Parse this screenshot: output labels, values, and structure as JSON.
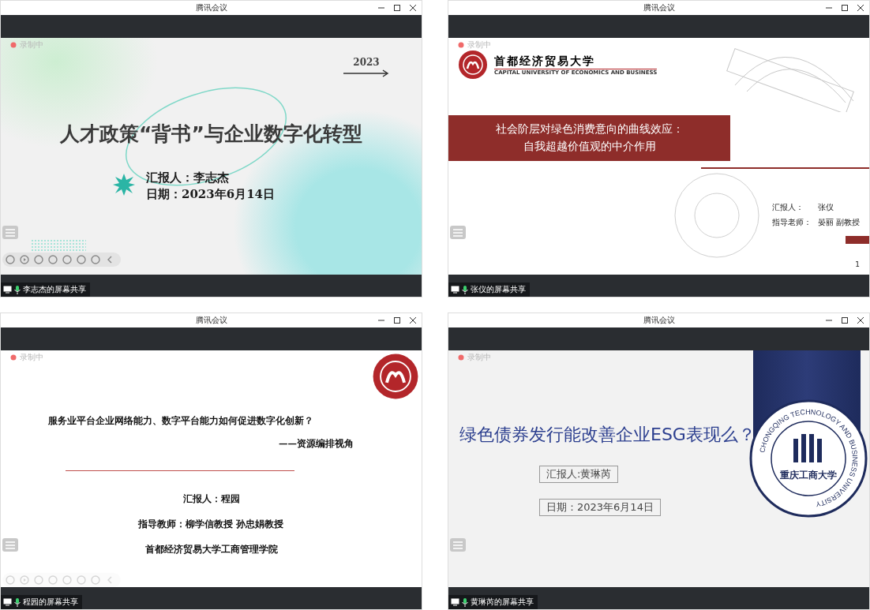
{
  "windows": [
    {
      "title": "腾讯会议",
      "recording": "录制中",
      "share_label": "李志杰的屏幕共享",
      "toolbar_dimmed": false,
      "slide": {
        "kind": "green",
        "year": "2023",
        "title": "人才政策“背书”与企业数字化转型",
        "lines": [
          "汇报人：李志杰",
          "日期：2023年6月14日"
        ]
      }
    },
    {
      "title": "腾讯会议",
      "recording": "录制中",
      "share_label": "张仪的屏幕共享",
      "slide": {
        "kind": "band",
        "logo_name": "首都经济贸易大学",
        "logo_subtitle": "CAPITAL UNIVERSITY OF ECONOMICS AND BUSINESS",
        "title_lines": [
          "社会阶层对绿色消费意向的曲线效应：",
          "自我超越价值观的中介作用"
        ],
        "credits": [
          {
            "label": "汇报人：",
            "value": "张仪"
          },
          {
            "label": "指导老师：",
            "value": "晏丽 副教授"
          }
        ],
        "page": "1"
      }
    },
    {
      "title": "腾讯会议",
      "recording": "录制中",
      "share_label": "程园的屏幕共享",
      "toolbar_dimmed": true,
      "slide": {
        "kind": "plain",
        "title": "服务业平台企业网络能力、数字平台能力如何促进数字化创新？",
        "subtitle": "——资源编排视角",
        "lines": [
          "汇报人：程园",
          "指导教师：柳学信教授 孙忠娟教授",
          "首都经济贸易大学工商管理学院"
        ]
      }
    },
    {
      "title": "腾讯会议",
      "recording": "录制中",
      "share_label": "黄琳芮的屏幕共享",
      "slide": {
        "kind": "emblem",
        "title": "绿色债券发行能改善企业ESG表现么？",
        "boxes": [
          "汇报人:黄琳芮",
          "日期：2023年6月14日"
        ],
        "emblem_ring": "CHONGQING TECHNOLOGY AND BUSINESS UNIVERSITY",
        "emblem_name": "重庆工商大学"
      }
    }
  ]
}
